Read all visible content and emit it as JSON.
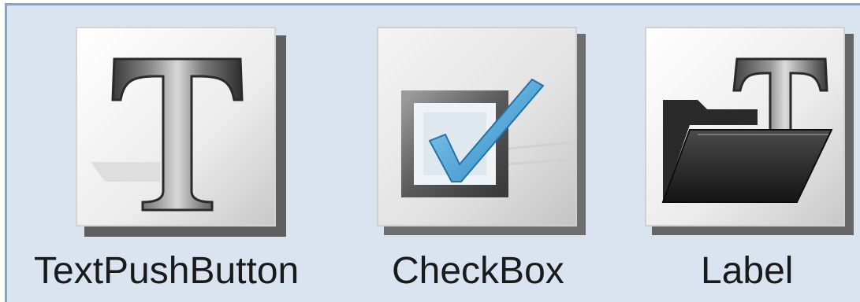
{
  "palette": {
    "items": [
      {
        "label": "TextPushButton",
        "icon": "text-push-button-icon"
      },
      {
        "label": "CheckBox",
        "icon": "checkbox-icon"
      },
      {
        "label": "Label",
        "icon": "label-icon"
      }
    ]
  },
  "colors": {
    "panel_background": "#dae4f0",
    "panel_border": "#8fa2b8",
    "checkmark": "#3a9dd8",
    "label_text": "#1a1a1a"
  }
}
